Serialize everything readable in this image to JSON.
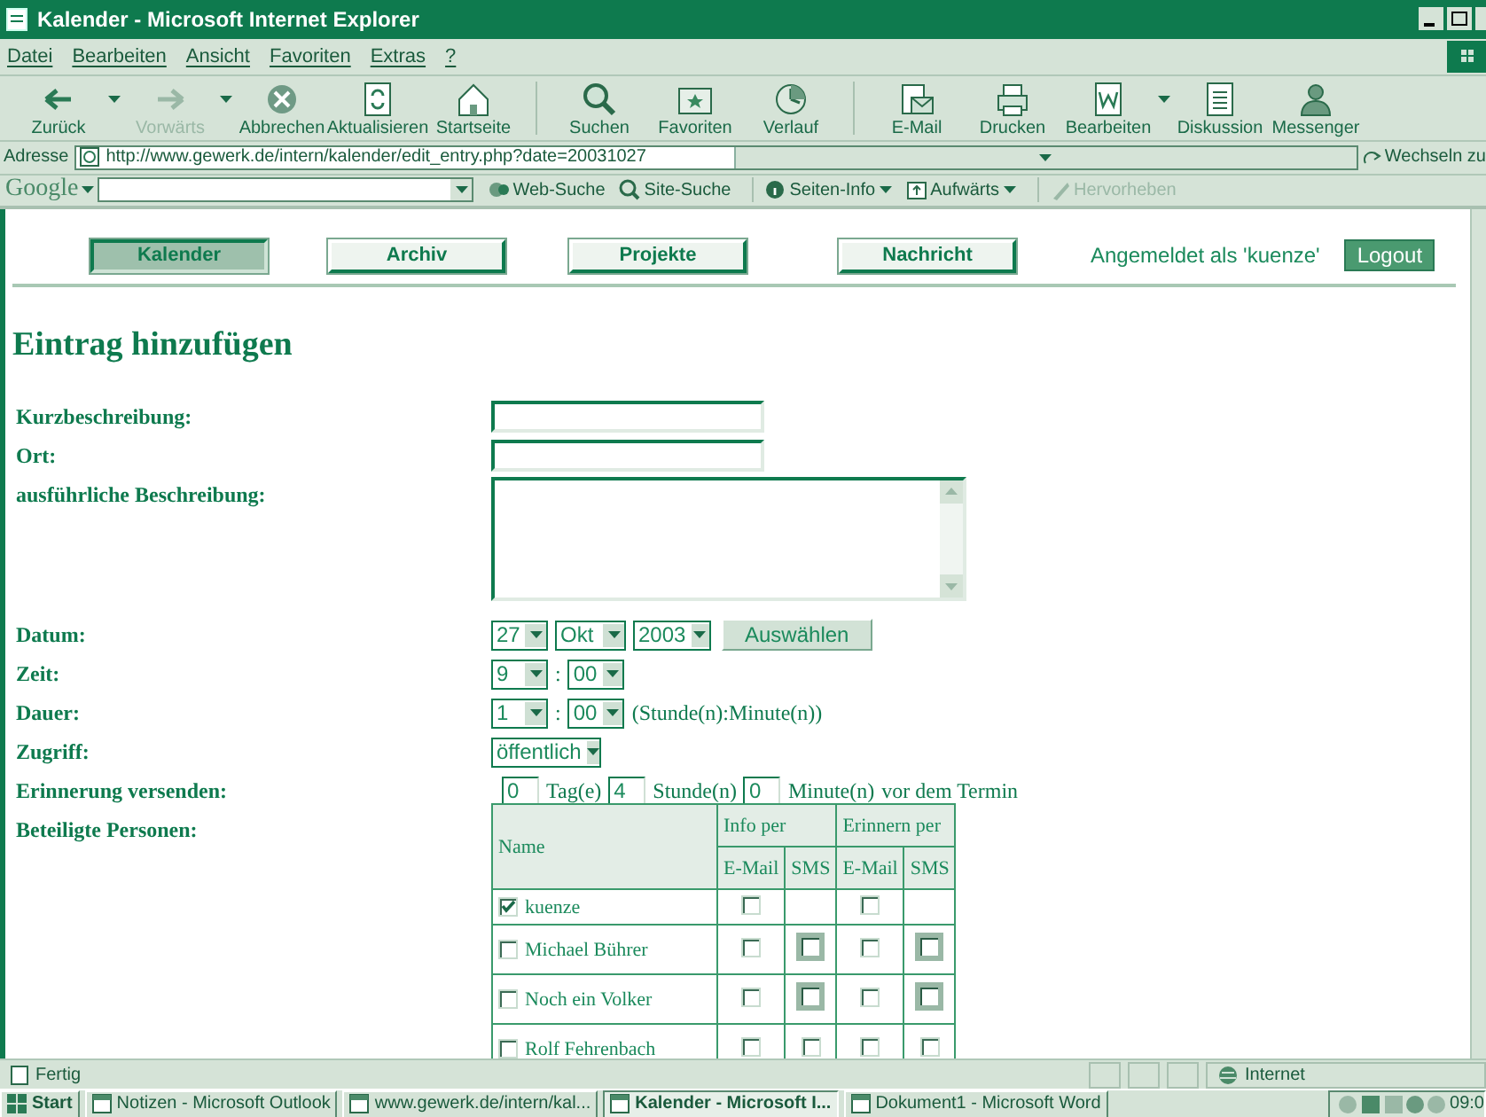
{
  "window": {
    "title": "Kalender - Microsoft Internet Explorer"
  },
  "menu": [
    "Datei",
    "Bearbeiten",
    "Ansicht",
    "Favoriten",
    "Extras",
    "?"
  ],
  "toolbar": [
    {
      "label": "Zurück",
      "disabled": false,
      "dropdown": true
    },
    {
      "label": "Vorwärts",
      "disabled": true,
      "dropdown": true
    },
    {
      "label": "Abbrechen",
      "disabled": false,
      "dropdown": false
    },
    {
      "label": "Aktualisieren",
      "disabled": false,
      "dropdown": false
    },
    {
      "label": "Startseite",
      "disabled": false,
      "dropdown": false
    },
    {
      "label": "Suchen",
      "disabled": false,
      "dropdown": false
    },
    {
      "label": "Favoriten",
      "disabled": false,
      "dropdown": false
    },
    {
      "label": "Verlauf",
      "disabled": false,
      "dropdown": false
    },
    {
      "label": "E-Mail",
      "disabled": false,
      "dropdown": false
    },
    {
      "label": "Drucken",
      "disabled": false,
      "dropdown": false
    },
    {
      "label": "Bearbeiten",
      "disabled": false,
      "dropdown": true
    },
    {
      "label": "Diskussion",
      "disabled": false,
      "dropdown": false
    },
    {
      "label": "Messenger",
      "disabled": false,
      "dropdown": false
    }
  ],
  "address": {
    "label": "Adresse",
    "url": "http://www.gewerk.de/intern/kalender/edit_entry.php?date=20031027",
    "go": "Wechseln zu"
  },
  "google": {
    "logo": "Google",
    "buttons": [
      {
        "label": "Web-Suche",
        "disabled": false,
        "dropdown": false
      },
      {
        "label": "Site-Suche",
        "disabled": false,
        "dropdown": false
      },
      {
        "label": "Seiten-Info",
        "disabled": false,
        "dropdown": true
      },
      {
        "label": "Aufwärts",
        "disabled": false,
        "dropdown": true
      },
      {
        "label": "Hervorheben",
        "disabled": true,
        "dropdown": false
      }
    ]
  },
  "nav": {
    "tabs": [
      {
        "label": "Kalender",
        "selected": true
      },
      {
        "label": "Archiv",
        "selected": false
      },
      {
        "label": "Projekte",
        "selected": false
      },
      {
        "label": "Nachricht",
        "selected": false
      }
    ],
    "login": "Angemeldet als 'kuenze'",
    "logout": "Logout"
  },
  "heading": "Eintrag hinzufügen",
  "fields": [
    {
      "kind": "text",
      "label": "Kurzbeschreibung:"
    },
    {
      "kind": "text",
      "label": "Ort:"
    },
    {
      "kind": "textarea",
      "label": "ausführliche Beschreibung:"
    },
    {
      "kind": "date",
      "label": "Datum:",
      "selects": [
        "27",
        "Okt",
        "2003"
      ],
      "button": "Auswählen"
    },
    {
      "kind": "time",
      "label": "Zeit:",
      "selects": [
        "9",
        "00"
      ],
      "separator": ":"
    },
    {
      "kind": "time",
      "label": "Dauer:",
      "selects": [
        "1",
        "00"
      ],
      "separator": ":",
      "note": "(Stunde(n):Minute(n))"
    },
    {
      "kind": "select",
      "label": "Zugriff:",
      "selects": [
        "öffentlich"
      ]
    },
    {
      "kind": "reminder",
      "label": "Erinnerung versenden:",
      "parts": [
        {
          "value": "0",
          "unit": "Tag(e)"
        },
        {
          "value": "4",
          "unit": "Stunde(n)"
        },
        {
          "value": "0",
          "unit": "Minute(n)"
        }
      ],
      "suffix": "vor dem Termin"
    },
    {
      "kind": "people",
      "label": "Beteiligte Personen:"
    }
  ],
  "participants": {
    "name_header": "Name",
    "groups": [
      "Info per",
      "Erinnern per"
    ],
    "sub": [
      "E-Mail",
      "SMS",
      "E-Mail",
      "SMS"
    ],
    "rows": [
      {
        "name": "kuenze",
        "checked": true,
        "cells": [
          {
            "kind": "check",
            "checked": false,
            "disabled": false
          },
          {
            "kind": "none"
          },
          {
            "kind": "check",
            "checked": false,
            "disabled": false
          },
          {
            "kind": "none"
          }
        ]
      },
      {
        "name": "Michael Bührer",
        "checked": false,
        "cells": [
          {
            "kind": "check",
            "checked": false,
            "disabled": false
          },
          {
            "kind": "check",
            "checked": false,
            "disabled": true
          },
          {
            "kind": "check",
            "checked": false,
            "disabled": false
          },
          {
            "kind": "check",
            "checked": false,
            "disabled": true
          }
        ]
      },
      {
        "name": "Noch ein Volker",
        "checked": false,
        "cells": [
          {
            "kind": "check",
            "checked": false,
            "disabled": false
          },
          {
            "kind": "check",
            "checked": false,
            "disabled": true
          },
          {
            "kind": "check",
            "checked": false,
            "disabled": false
          },
          {
            "kind": "check",
            "checked": false,
            "disabled": true
          }
        ]
      },
      {
        "name": "Rolf Fehrenbach",
        "checked": false,
        "cells": [
          {
            "kind": "check",
            "checked": false,
            "disabled": false
          },
          {
            "kind": "check",
            "checked": false,
            "disabled": false
          },
          {
            "kind": "check",
            "checked": false,
            "disabled": false
          },
          {
            "kind": "check",
            "checked": false,
            "disabled": false
          }
        ]
      }
    ]
  },
  "status": {
    "text": "Fertig",
    "zone": "Internet"
  },
  "taskbar": {
    "start": "Start",
    "tasks": [
      {
        "label": "Notizen - Microsoft Outlook",
        "selected": false
      },
      {
        "label": "www.gewerk.de/intern/kal...",
        "selected": false
      },
      {
        "label": "Kalender - Microsoft I...",
        "selected": true
      },
      {
        "label": "Dokument1 - Microsoft Word",
        "selected": false
      }
    ],
    "clock": "09:0"
  }
}
